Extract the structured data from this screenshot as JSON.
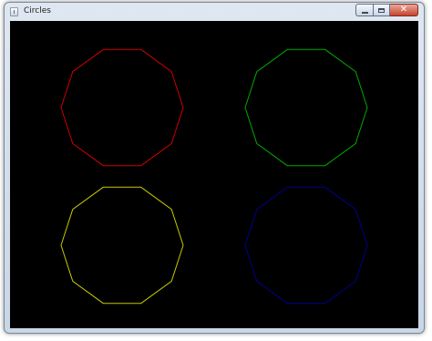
{
  "window": {
    "title": "Circles"
  },
  "icons": {
    "app": "app-icon",
    "minimize": "minimize-icon",
    "maximize": "maximize-icon",
    "close": "close-icon"
  },
  "canvas": {
    "background": "#000000",
    "shapes": [
      {
        "name": "red-decagon",
        "color": "#cc0000"
      },
      {
        "name": "green-decagon",
        "color": "#00a800"
      },
      {
        "name": "yellow-decagon",
        "color": "#c8c800"
      },
      {
        "name": "blue-decagon",
        "color": "#00008c"
      }
    ]
  }
}
